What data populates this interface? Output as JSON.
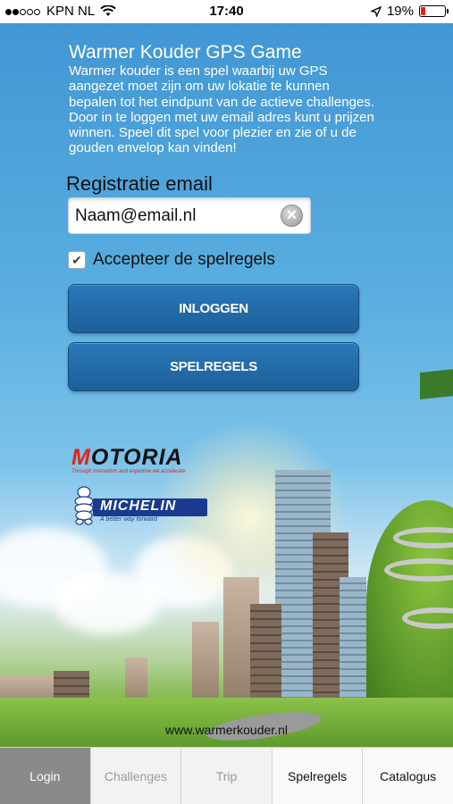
{
  "status_bar": {
    "carrier": "KPN NL",
    "time": "17:40",
    "battery_percent": "19%",
    "battery_level": 0.19,
    "battery_color": "#e2231a"
  },
  "app": {
    "title": "Warmer Kouder GPS Game",
    "intro": "Warmer kouder is een spel waarbij uw GPS aangezet moet zijn om uw lokatie te kunnen bepalen tot het eindpunt van de actieve challenges. Door in te loggen met uw email adres kunt u prijzen winnen. Speel dit spel voor plezier en zie of u de gouden envelop kan vinden!"
  },
  "form": {
    "email_label": "Registratie email",
    "email_value": "Naam@email.nl",
    "accept_label": "Accepteer de spelregels",
    "accept_checked": true,
    "login_button": "INLOGGEN",
    "rules_button": "SPELREGELS"
  },
  "sponsors": {
    "motoria_name": "MOTORIA",
    "motoria_tagline": "Through innovation and expertise we accelerate",
    "michelin_name": "MICHELIN",
    "michelin_tagline": "A better way forward"
  },
  "footer": {
    "website": "www.warmerkouder.nl"
  },
  "tabs": [
    {
      "label": "Login",
      "state": "active"
    },
    {
      "label": "Challenges",
      "state": "disabled"
    },
    {
      "label": "Trip",
      "state": "disabled"
    },
    {
      "label": "Spelregels",
      "state": "enabled"
    },
    {
      "label": "Catalogus",
      "state": "enabled"
    }
  ],
  "colors": {
    "button_blue": "#2a78b9",
    "active_tab": "#8a8a8a"
  }
}
